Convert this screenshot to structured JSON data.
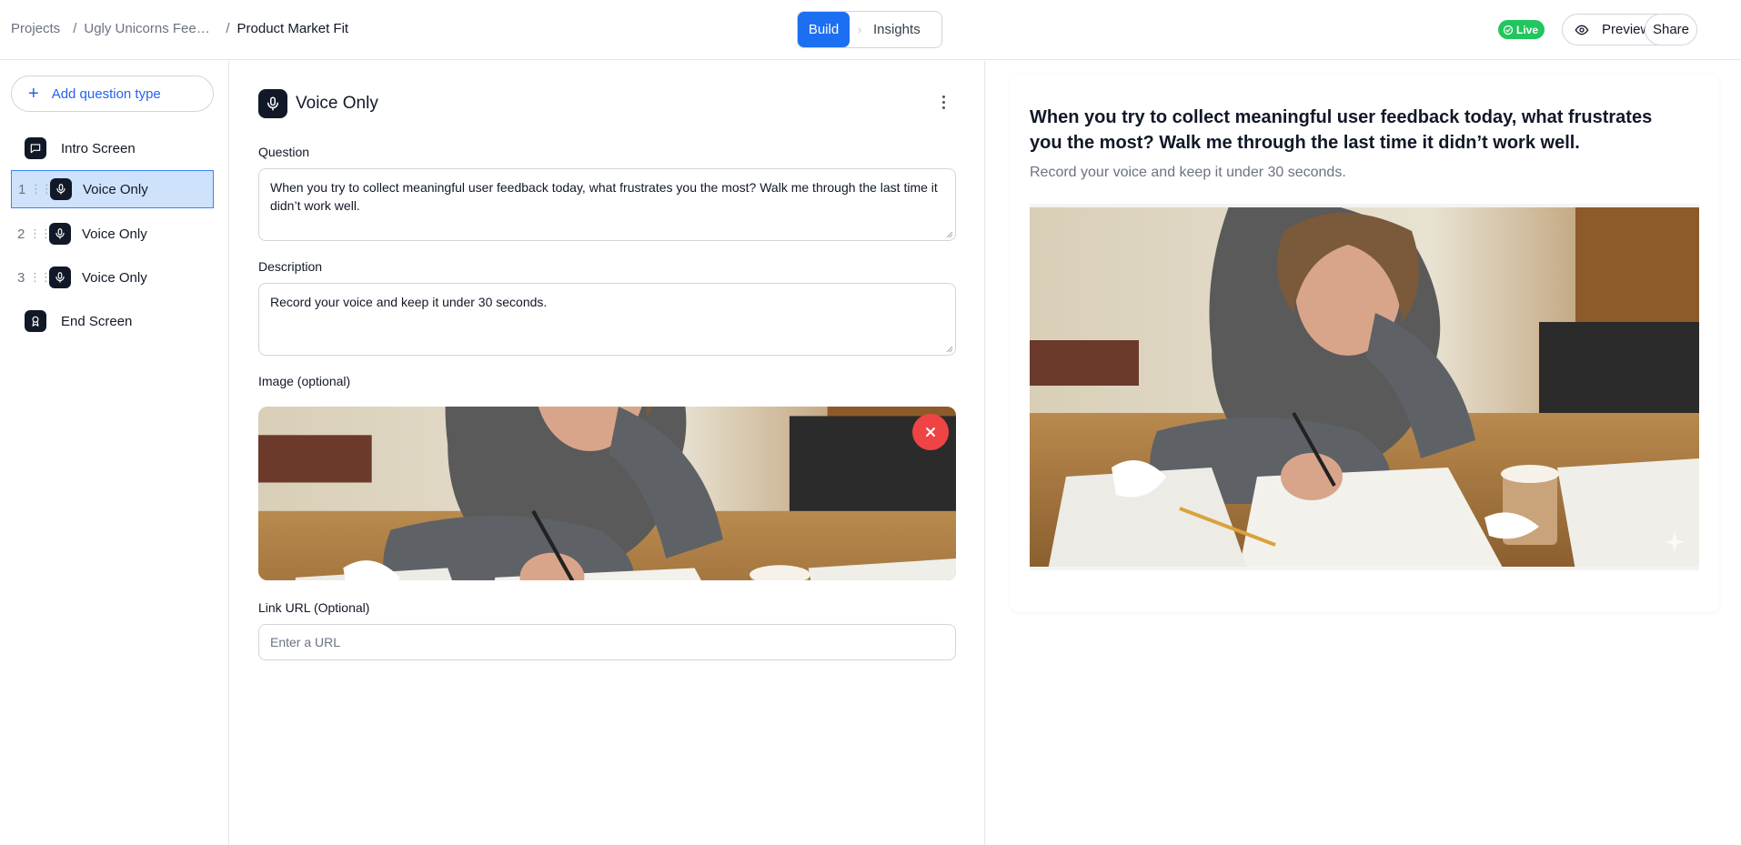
{
  "breadcrumb": {
    "projects": "Projects",
    "project_name": "Ugly Unicorns Feedback",
    "page": "Product Market Fit",
    "separator": "/"
  },
  "modes": {
    "build": "Build",
    "insights": "Insights"
  },
  "status": {
    "live": "Live"
  },
  "actions": {
    "preview": "Preview",
    "share": "Share"
  },
  "sidebar": {
    "add_label": "Add question type",
    "items": [
      {
        "label": "Intro Screen",
        "icon": "message-square-icon"
      },
      {
        "num": "1",
        "label": "Voice Only",
        "icon": "mic-icon",
        "active": true
      },
      {
        "num": "2",
        "label": "Voice Only",
        "icon": "mic-icon"
      },
      {
        "num": "3",
        "label": "Voice Only",
        "icon": "mic-icon"
      },
      {
        "label": "End Screen",
        "icon": "award-icon"
      }
    ]
  },
  "editor": {
    "title": "Voice Only",
    "question_label": "Question",
    "question_value": "When you try to collect meaningful user feedback today, what frustrates you the most? Walk me through the last time it didn’t work well.",
    "description_label": "Description",
    "description_value": "Record your voice and keep it under 30 seconds.",
    "image_label": "Image (optional)",
    "link_label": "Link URL (Optional)",
    "link_placeholder": "Enter a URL"
  },
  "preview": {
    "question": "When you try to collect meaningful user feedback today, what frustrates you the most? Walk me through the last time it didn’t work well.",
    "description": "Record your voice and keep it under 30 seconds."
  },
  "colors": {
    "accent": "#1d6ff2",
    "live": "#22c55e",
    "remove": "#ef4444",
    "active_item": "#cfe2fb"
  }
}
